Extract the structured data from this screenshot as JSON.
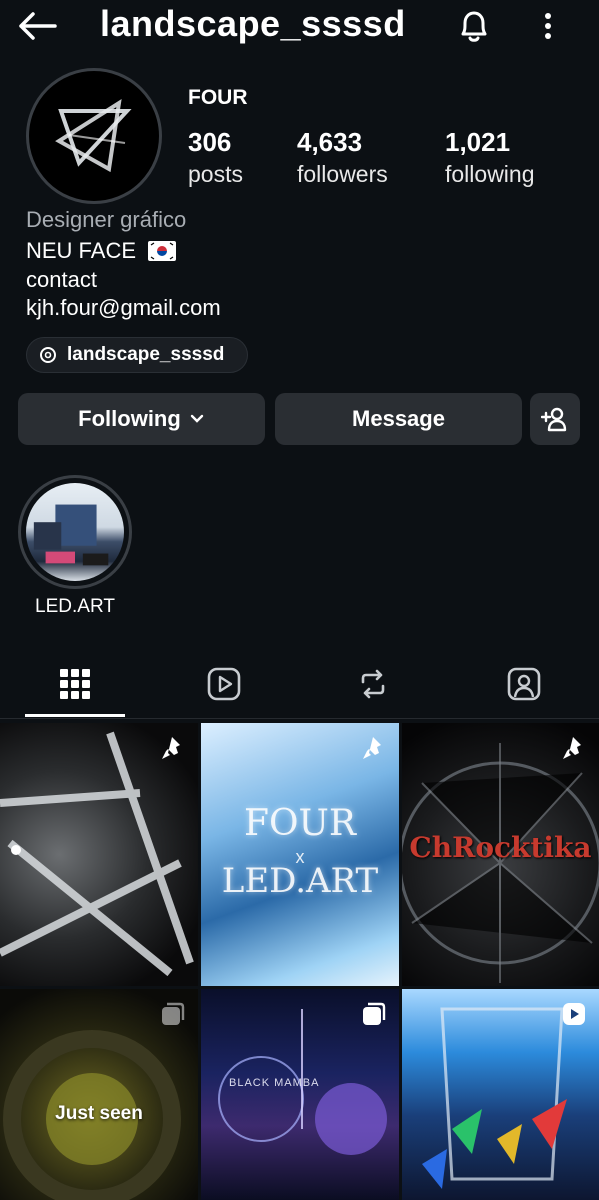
{
  "header": {
    "title": "landscape_ssssd"
  },
  "profile": {
    "display_name": "FOUR",
    "stats": [
      {
        "value": "306",
        "label": "posts"
      },
      {
        "value": "4,633",
        "label": "followers"
      },
      {
        "value": "1,021",
        "label": "following"
      }
    ],
    "bio": {
      "category": "Designer gráfico",
      "line1": "NEU FACE",
      "line2": "contact",
      "line3": "kjh.four@gmail.com"
    },
    "threads_handle": "landscape_ssssd"
  },
  "actions": {
    "following_label": "Following",
    "message_label": "Message"
  },
  "highlights": [
    {
      "label": "LED.ART"
    }
  ],
  "tabs": [
    {
      "icon": "grid-icon",
      "active": true
    },
    {
      "icon": "reels-icon",
      "active": false
    },
    {
      "icon": "reposts-icon",
      "active": false
    },
    {
      "icon": "tagged-icon",
      "active": false
    }
  ],
  "grid": {
    "tile2_line1": "FOUR",
    "tile2_line2": "x",
    "tile2_line3": "LED.ART",
    "tile3_text": "ChRocktika",
    "tile4_overlay": "Just seen",
    "tile5_text": "BLACK MAMBA"
  },
  "colors": {
    "background": "#0c1014",
    "button": "#2a2e33",
    "secondary_text": "#a8adb3"
  }
}
